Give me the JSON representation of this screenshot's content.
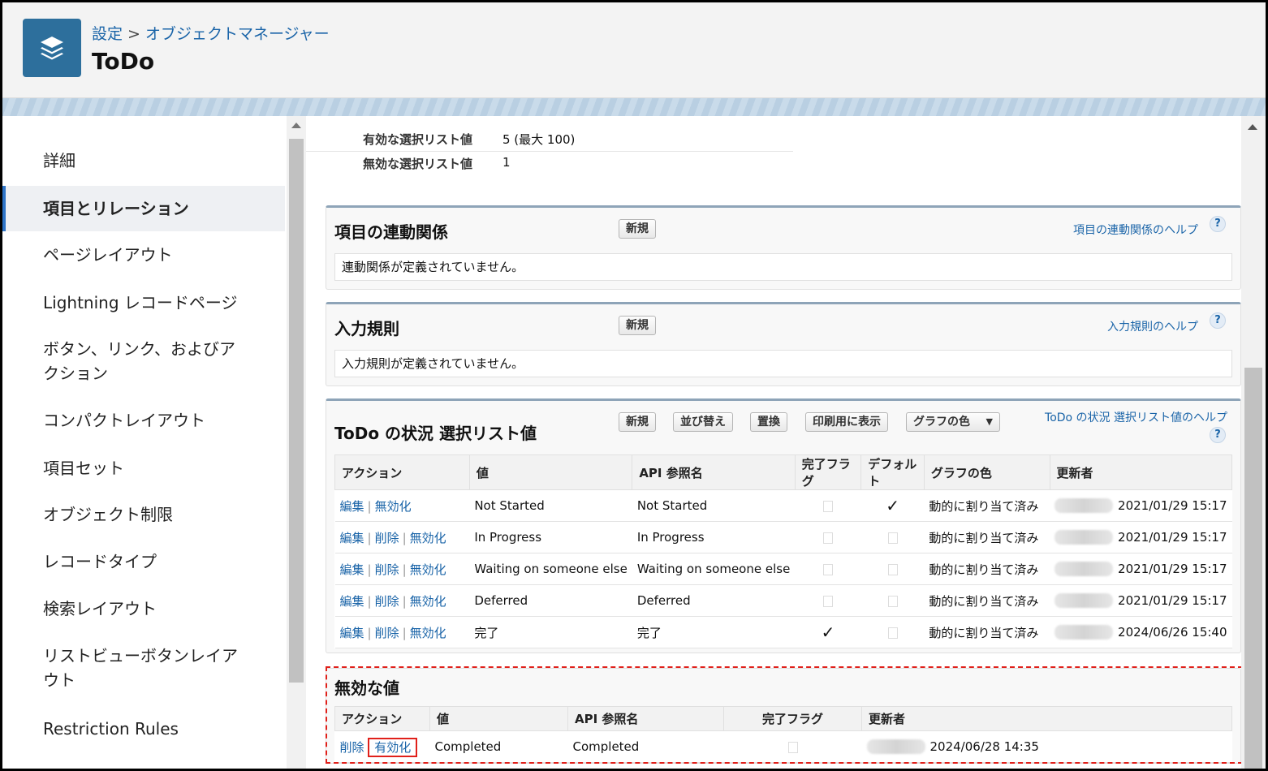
{
  "header": {
    "breadcrumb": [
      "設定",
      "オブジェクトマネージャー"
    ],
    "breadcrumb_sep": ">",
    "title": "ToDo",
    "icon": "layers-icon"
  },
  "sidebar": {
    "items": [
      {
        "label": "詳細",
        "active": false
      },
      {
        "label": "項目とリレーション",
        "active": true
      },
      {
        "label": "ページレイアウト",
        "active": false
      },
      {
        "label": "Lightning レコードページ",
        "active": false
      },
      {
        "label": "ボタン、リンク、およびアクション",
        "active": false
      },
      {
        "label": "コンパクトレイアウト",
        "active": false
      },
      {
        "label": "項目セット",
        "active": false
      },
      {
        "label": "オブジェクト制限",
        "active": false
      },
      {
        "label": "レコードタイプ",
        "active": false
      },
      {
        "label": "検索レイアウト",
        "active": false
      },
      {
        "label": "リストビューボタンレイアウト",
        "active": false
      },
      {
        "label": "Restriction Rules",
        "active": false
      }
    ]
  },
  "picklist_summary": {
    "active_label": "有効な選択リスト値",
    "active_value": "5 (最大 100)",
    "inactive_label": "無効な選択リスト値",
    "inactive_value": "1"
  },
  "dependencies": {
    "title": "項目の連動関係",
    "new_label": "新規",
    "help": "項目の連動関係のヘルプ",
    "message": "連動関係が定義されていません。"
  },
  "validation": {
    "title": "入力規則",
    "new_label": "新規",
    "help": "入力規則のヘルプ",
    "message": "入力規則が定義されていません。"
  },
  "picklist": {
    "title": "ToDo の状況 選択リスト値",
    "buttons": {
      "new": "新規",
      "reorder": "並び替え",
      "replace": "置換",
      "print": "印刷用に表示",
      "chart": "グラフの色"
    },
    "help": "ToDo の状況 選択リスト値のヘルプ",
    "columns": [
      "アクション",
      "値",
      "API 参照名",
      "完了フラグ",
      "デフォルト",
      "グラフの色",
      "更新者"
    ],
    "action_labels": {
      "edit": "編集",
      "delete": "削除",
      "deactivate": "無効化"
    },
    "rows": [
      {
        "actions": [
          "編集",
          "無効化"
        ],
        "value": "Not Started",
        "api": "Not Started",
        "closed": false,
        "default": true,
        "color": "動的に割り当て済み",
        "updated": "2021/01/29 15:17"
      },
      {
        "actions": [
          "編集",
          "削除",
          "無効化"
        ],
        "value": "In Progress",
        "api": "In Progress",
        "closed": false,
        "default": false,
        "color": "動的に割り当て済み",
        "updated": "2021/01/29 15:17"
      },
      {
        "actions": [
          "編集",
          "削除",
          "無効化"
        ],
        "value": "Waiting on someone else",
        "api": "Waiting on someone else",
        "closed": false,
        "default": false,
        "color": "動的に割り当て済み",
        "updated": "2021/01/29 15:17"
      },
      {
        "actions": [
          "編集",
          "削除",
          "無効化"
        ],
        "value": "Deferred",
        "api": "Deferred",
        "closed": false,
        "default": false,
        "color": "動的に割り当て済み",
        "updated": "2021/01/29 15:17"
      },
      {
        "actions": [
          "編集",
          "削除",
          "無効化"
        ],
        "value": "完了",
        "api": "完了",
        "closed": true,
        "default": false,
        "color": "動的に割り当て済み",
        "updated": "2024/06/26 15:40"
      }
    ]
  },
  "inactive": {
    "title": "無効な値",
    "columns": [
      "アクション",
      "値",
      "API 参照名",
      "完了フラグ",
      "更新者"
    ],
    "rows": [
      {
        "delete": "削除",
        "activate": "有効化",
        "value": "Completed",
        "api": "Completed",
        "closed": false,
        "updated": "2024/06/28 14:35"
      }
    ]
  },
  "colors": {
    "link": "#1a64a8",
    "highlight": "#e0201a",
    "header_icon": "#2d6f9c"
  }
}
